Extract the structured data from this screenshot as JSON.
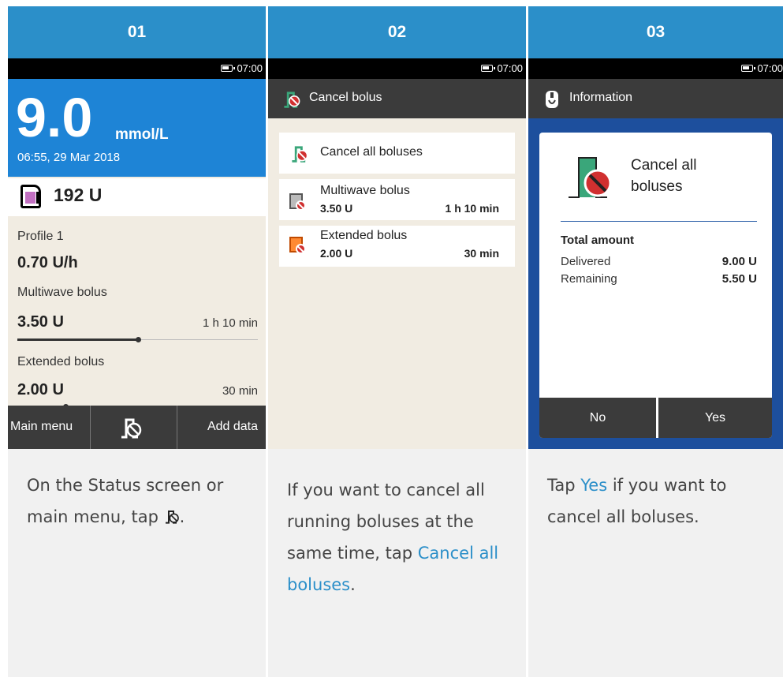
{
  "steps": [
    {
      "number": "01"
    },
    {
      "number": "02"
    },
    {
      "number": "03"
    }
  ],
  "statusbar": {
    "time": "07:00"
  },
  "status_screen": {
    "glucose_value": "9.0",
    "glucose_unit": "mmol/L",
    "timestamp": "06:55, 29 Mar 2018",
    "reservoir": "192 U",
    "profile_label": "Profile 1",
    "basal_rate": "0.70 U/h",
    "multiwave_label": "Multiwave bolus",
    "multiwave_amount": "3.50 U",
    "multiwave_duration": "1 h 10 min",
    "multiwave_progress": 0.5,
    "extended_label": "Extended bolus",
    "extended_amount": "2.00 U",
    "extended_duration": "30 min",
    "extended_progress": 0.2,
    "main_menu": "Main menu",
    "add_data": "Add data"
  },
  "cancel_screen": {
    "title": "Cancel bolus",
    "cancel_all": "Cancel all boluses",
    "multiwave_label": "Multiwave bolus",
    "multiwave_amount": "3.50 U",
    "multiwave_duration": "1 h 10 min",
    "extended_label": "Extended bolus",
    "extended_amount": "2.00 U",
    "extended_duration": "30 min"
  },
  "info_screen": {
    "title": "Information",
    "message_line1": "Cancel all",
    "message_line2": "boluses",
    "total_label": "Total amount",
    "delivered_label": "Delivered",
    "delivered_value": "9.00 U",
    "remaining_label": "Remaining",
    "remaining_value": "5.50 U",
    "no": "No",
    "yes": "Yes"
  },
  "captions": {
    "c1_text": "On the Status screen or main menu, tap ",
    "c1_end": ".",
    "c2_pre": "If you want to cancel all running boluses at the same time, tap ",
    "c2_link": "Cancel all boluses",
    "c2_end": ".",
    "c3_pre": "Tap ",
    "c3_link": "Yes",
    "c3_post": " if you want to cancel all boluses."
  },
  "colors": {
    "step_header": "#2b8fc9",
    "glucose_banner": "#1e84d6",
    "info_background": "#1d4f9d",
    "link": "#2b8fc9"
  }
}
